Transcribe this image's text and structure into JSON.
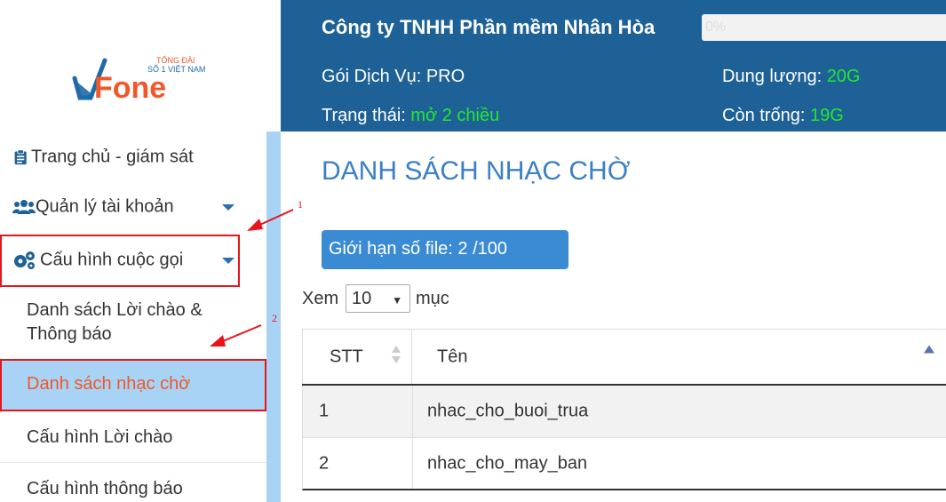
{
  "brand": {
    "logo_text": "Fone",
    "logo_tag_1": "TỔNG ĐÀI",
    "logo_tag_2": "SỐ 1 VIỆT NAM"
  },
  "sidebar": {
    "items": [
      {
        "label": "Trang chủ - giám sát",
        "icon": "clipboard-icon"
      },
      {
        "label": "Quản lý tài khoản",
        "icon": "users-icon"
      },
      {
        "label": "Cấu hình cuộc gọi",
        "icon": "gears-icon"
      }
    ],
    "sub_items": [
      {
        "label": "Danh sách Lời chào &",
        "label2": "Thông báo"
      },
      {
        "label": "Danh sách nhạc chờ"
      },
      {
        "label": "Cấu hình Lời chào"
      },
      {
        "label": "Cấu hình thông báo"
      }
    ]
  },
  "header": {
    "company": "Công ty TNHH Phần mềm Nhân Hòa",
    "progress_text": "0%",
    "progress_value": 0,
    "plan_label": "Gói Dịch Vụ: ",
    "plan_value": "PRO",
    "status_label": "Trạng thái: ",
    "status_value": "mở 2 chiều",
    "capacity_label": "Dung lượng: ",
    "capacity_value": "20G",
    "free_label": "Còn trống: ",
    "free_value": "19G"
  },
  "main": {
    "title": "DANH SÁCH NHẠC CHỜ",
    "file_limit": "Giới hạn số file:  2  /100",
    "show_label": "Xem",
    "show_value": "10",
    "show_suffix": "mục",
    "columns": [
      "STT",
      "Tên"
    ],
    "rows": [
      [
        "1",
        "nhac_cho_buoi_trua"
      ],
      [
        "2",
        "nhac_cho_may_ban"
      ]
    ]
  },
  "annotations": {
    "step1": "1",
    "step2": "2"
  },
  "colors": {
    "header_bg": "#1d6196",
    "accent": "#3a8bd4",
    "highlight": "#a9d3f5",
    "active_text": "#f0582a",
    "green": "#22e830",
    "annotation_red": "#e8141a"
  }
}
